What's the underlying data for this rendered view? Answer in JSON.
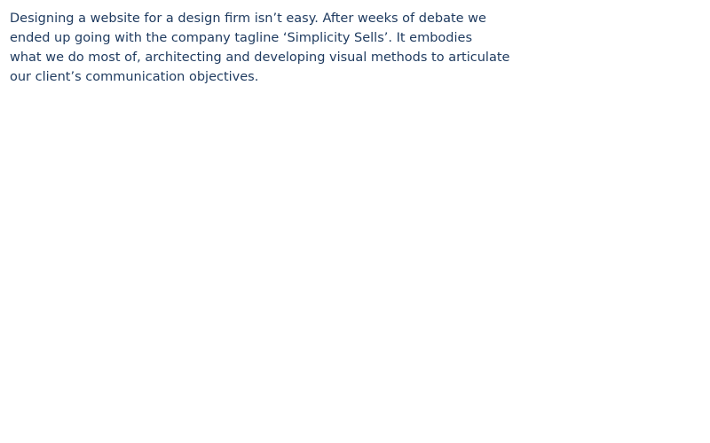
{
  "intro": {
    "lines": [
      "Designing a website for a design firm isn’t easy. After weeks of debate we",
      "ended up going with the company tagline ‘Simplicity Sells’. It embodies",
      "what we do most of, architecting and developing visual methods to articulate",
      "our client’s communication objectives."
    ],
    "text_color": "#1e3a5f"
  }
}
